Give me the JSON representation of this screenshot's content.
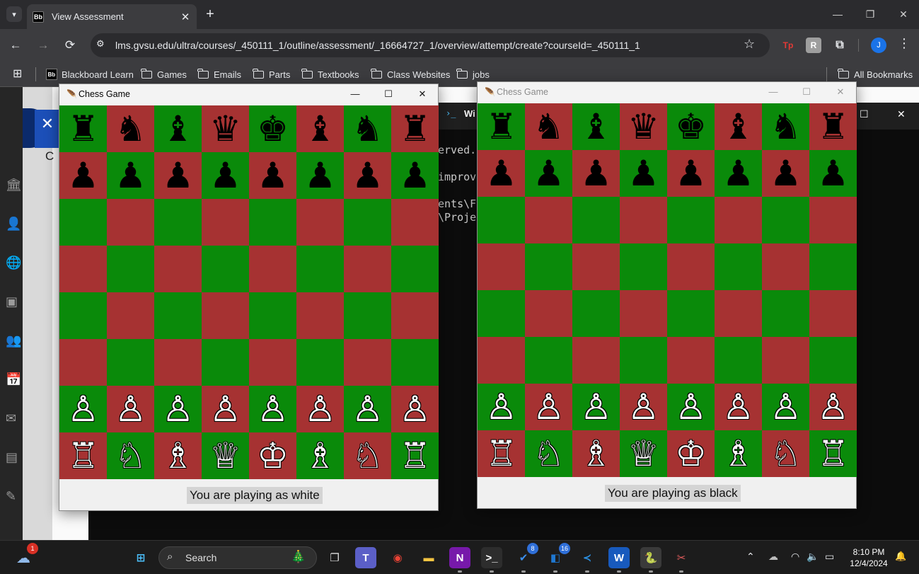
{
  "browser": {
    "tab_list_icon": "chevron-down-icon",
    "tab": {
      "favicon_text": "Bb",
      "title": "View Assessment",
      "close": "✕"
    },
    "new_tab": "+",
    "window_controls": {
      "minimize": "—",
      "restore": "❐",
      "close": "✕"
    },
    "nav": {
      "back": "←",
      "forward": "→",
      "reload": "⟳"
    },
    "site_info": "⚙",
    "url": "lms.gvsu.edu/ultra/courses/_450111_1/outline/assessment/_16664727_1/overview/attempt/create?courseId=_450111_1",
    "bookmark_star": "☆",
    "extensions": [
      {
        "label": "Tp",
        "color": "#e53935"
      },
      {
        "label": "R",
        "color": "#9e9e9e"
      },
      {
        "label": "⧉",
        "color": "#e8eaed"
      }
    ],
    "profile": "J",
    "menu": "⋮",
    "apps_icon": "⊞",
    "bookmarks": [
      {
        "label": "Blackboard Learn",
        "icon": "bb"
      },
      {
        "label": "Games",
        "icon": "folder"
      },
      {
        "label": "Emails",
        "icon": "folder"
      },
      {
        "label": "Parts",
        "icon": "folder"
      },
      {
        "label": "Textbooks",
        "icon": "folder"
      },
      {
        "label": "Class Websites",
        "icon": "folder"
      },
      {
        "label": "jobs",
        "icon": "folder"
      }
    ],
    "all_bookmarks": "All Bookmarks"
  },
  "terminal": {
    "title": "Wi",
    "icon": "›_",
    "max": "☐",
    "close": "✕",
    "lines": [
      "erved.",
      "improv",
      "ents\\F",
      "\\Proje"
    ]
  },
  "lms_page": {
    "close_icon": "✕",
    "partial_letter": "C",
    "sidebar_icons": [
      "🏛",
      "👤",
      "🌐",
      "▣",
      "👥",
      "📅",
      "✉",
      "▤",
      "✎"
    ]
  },
  "colors": {
    "square_dark": "#a63232",
    "square_light": "#0a8a0a"
  },
  "chess_windows": [
    {
      "title": "Chess Game",
      "active": true,
      "feather_icon": "feather-icon",
      "controls": {
        "minimize": "—",
        "maximize": "☐",
        "close": "✕"
      },
      "status": "You are playing as white",
      "board": [
        [
          "♜",
          "♞",
          "♝",
          "♛",
          "♚",
          "♝",
          "♞",
          "♜"
        ],
        [
          "♟",
          "♟",
          "♟",
          "♟",
          "♟",
          "♟",
          "♟",
          "♟"
        ],
        [
          "",
          "",
          "",
          "",
          "",
          "",
          "",
          ""
        ],
        [
          "",
          "",
          "",
          "",
          "",
          "",
          "",
          ""
        ],
        [
          "",
          "",
          "",
          "",
          "",
          "",
          "",
          ""
        ],
        [
          "",
          "",
          "",
          "",
          "",
          "",
          "",
          ""
        ],
        [
          "♙",
          "♙",
          "♙",
          "♙",
          "♙",
          "♙",
          "♙",
          "♙"
        ],
        [
          "♖",
          "♘",
          "♗",
          "♕",
          "♔",
          "♗",
          "♘",
          "♖"
        ]
      ]
    },
    {
      "title": "Chess Game",
      "active": false,
      "feather_icon": "feather-icon",
      "controls": {
        "minimize": "—",
        "maximize": "☐",
        "close": "✕"
      },
      "status": "You are playing as black",
      "board": [
        [
          "♜",
          "♞",
          "♝",
          "♛",
          "♚",
          "♝",
          "♞",
          "♜"
        ],
        [
          "♟",
          "♟",
          "♟",
          "♟",
          "♟",
          "♟",
          "♟",
          "♟"
        ],
        [
          "",
          "",
          "",
          "",
          "",
          "",
          "",
          ""
        ],
        [
          "",
          "",
          "",
          "",
          "",
          "",
          "",
          ""
        ],
        [
          "",
          "",
          "",
          "",
          "",
          "",
          "",
          ""
        ],
        [
          "",
          "",
          "",
          "",
          "",
          "",
          "",
          ""
        ],
        [
          "♙",
          "♙",
          "♙",
          "♙",
          "♙",
          "♙",
          "♙",
          "♙"
        ],
        [
          "♖",
          "♘",
          "♗",
          "♕",
          "♔",
          "♗",
          "♘",
          "♖"
        ]
      ]
    }
  ],
  "taskbar": {
    "weather_badge": "1",
    "search_placeholder": "Search",
    "apps": [
      {
        "name": "windows-start",
        "glyph": "⊞",
        "bg": "transparent",
        "color": "#4cc2ff"
      },
      {
        "name": "task-view",
        "glyph": "❐",
        "bg": "transparent",
        "color": "#dddddd"
      },
      {
        "name": "teams",
        "glyph": "T",
        "bg": "#5b5fc7",
        "color": "#ffffff"
      },
      {
        "name": "chrome",
        "glyph": "◉",
        "bg": "transparent",
        "color": "#ea4335"
      },
      {
        "name": "file-explorer",
        "glyph": "▬",
        "bg": "transparent",
        "color": "#f4c542"
      },
      {
        "name": "onenote",
        "glyph": "N",
        "bg": "#7719aa",
        "color": "#ffffff"
      },
      {
        "name": "terminal",
        "glyph": ">_",
        "bg": "#2d2d2d",
        "color": "#ffffff"
      },
      {
        "name": "todo",
        "glyph": "✔",
        "bg": "transparent",
        "color": "#3b8eea",
        "badge": "8"
      },
      {
        "name": "outlook",
        "glyph": "◧",
        "bg": "transparent",
        "color": "#1f78d1",
        "badge": "16"
      },
      {
        "name": "vscode",
        "glyph": "≺",
        "bg": "transparent",
        "color": "#2b8fe0"
      },
      {
        "name": "word",
        "glyph": "W",
        "bg": "#185abd",
        "color": "#ffffff"
      },
      {
        "name": "python",
        "glyph": "🐍",
        "bg": "#3a3a3a",
        "color": "#f7d44c"
      },
      {
        "name": "snipping",
        "glyph": "✂",
        "bg": "transparent",
        "color": "#e15c5c"
      }
    ],
    "tray": {
      "chevron": "⌃",
      "wifi": "◠",
      "volume": "🔈",
      "battery": "▭",
      "bell": "🔔"
    },
    "time": "8:10 PM",
    "date": "12/4/2024"
  }
}
